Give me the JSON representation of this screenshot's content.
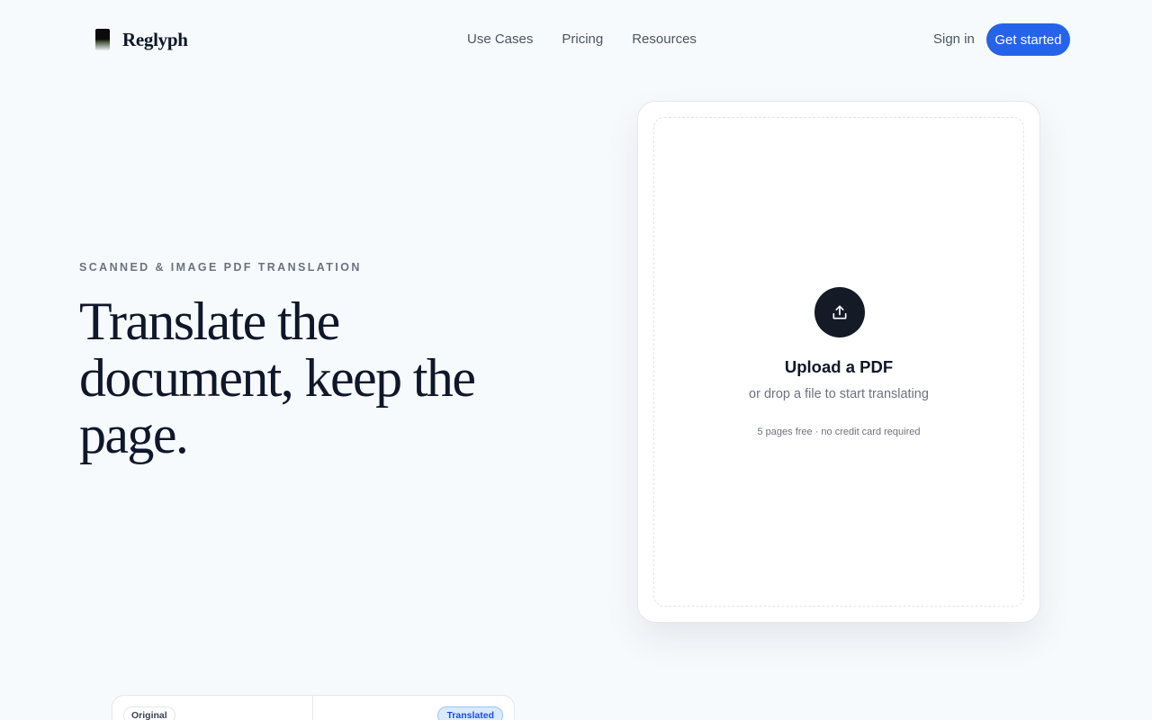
{
  "header": {
    "brand": "Reglyph",
    "nav": [
      "Use Cases",
      "Pricing",
      "Resources"
    ],
    "sign_in": "Sign in",
    "get_started": "Get started"
  },
  "hero": {
    "eyebrow": "SCANNED & IMAGE PDF TRANSLATION",
    "title": "Translate the document, keep the page."
  },
  "upload": {
    "icon": "upload-icon",
    "title": "Upload a PDF",
    "subtitle": "or drop a file to start translating",
    "note": "5 pages free · no credit card required"
  },
  "compare": {
    "original_label": "Original",
    "translated_label": "Translated"
  },
  "colors": {
    "accent": "#2563eb",
    "background": "#f7fafd",
    "text": "#0f172a",
    "muted": "#6b7280",
    "icon_circle": "#141a26"
  }
}
